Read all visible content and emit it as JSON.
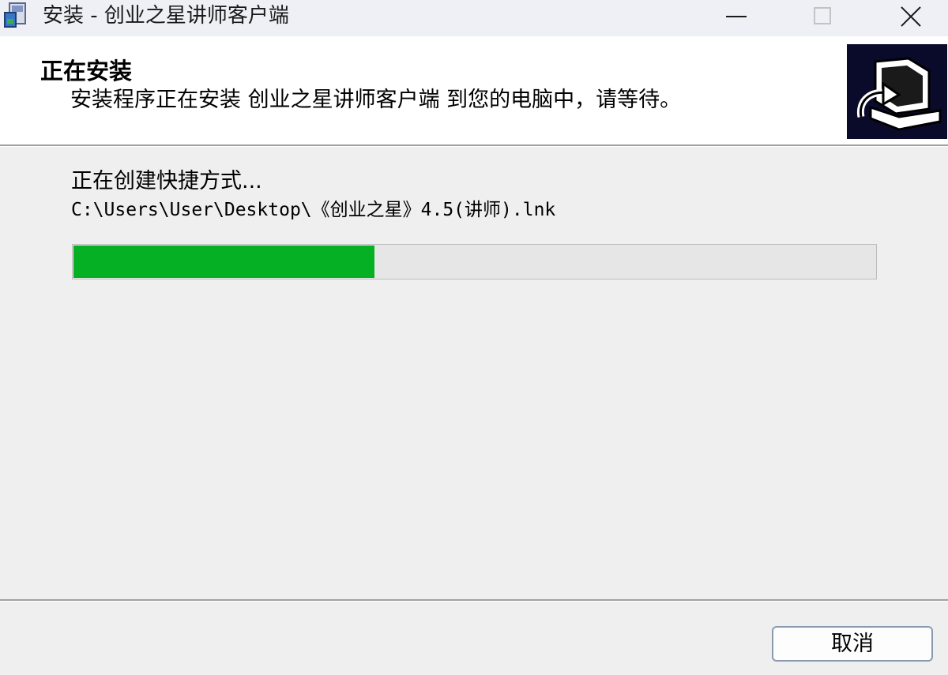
{
  "window": {
    "title": "安装 - 创业之星讲师客户端",
    "icon": "installer-icon"
  },
  "controls": {
    "minimize_icon": "minimize-icon",
    "maximize_icon": "maximize-icon",
    "close_icon": "close-icon"
  },
  "header": {
    "title": "正在安装",
    "description": "安装程序正在安装 创业之星讲师客户端 到您的电脑中，请等待。",
    "logo_icon": "computer-install-icon"
  },
  "body": {
    "status": "正在创建快捷方式...",
    "path": "C:\\Users\\User\\Desktop\\《创业之星》4.5(讲师).lnk",
    "progress_fraction": 0.375,
    "progress_color": "#06b025"
  },
  "footer": {
    "cancel_label": "取消"
  }
}
